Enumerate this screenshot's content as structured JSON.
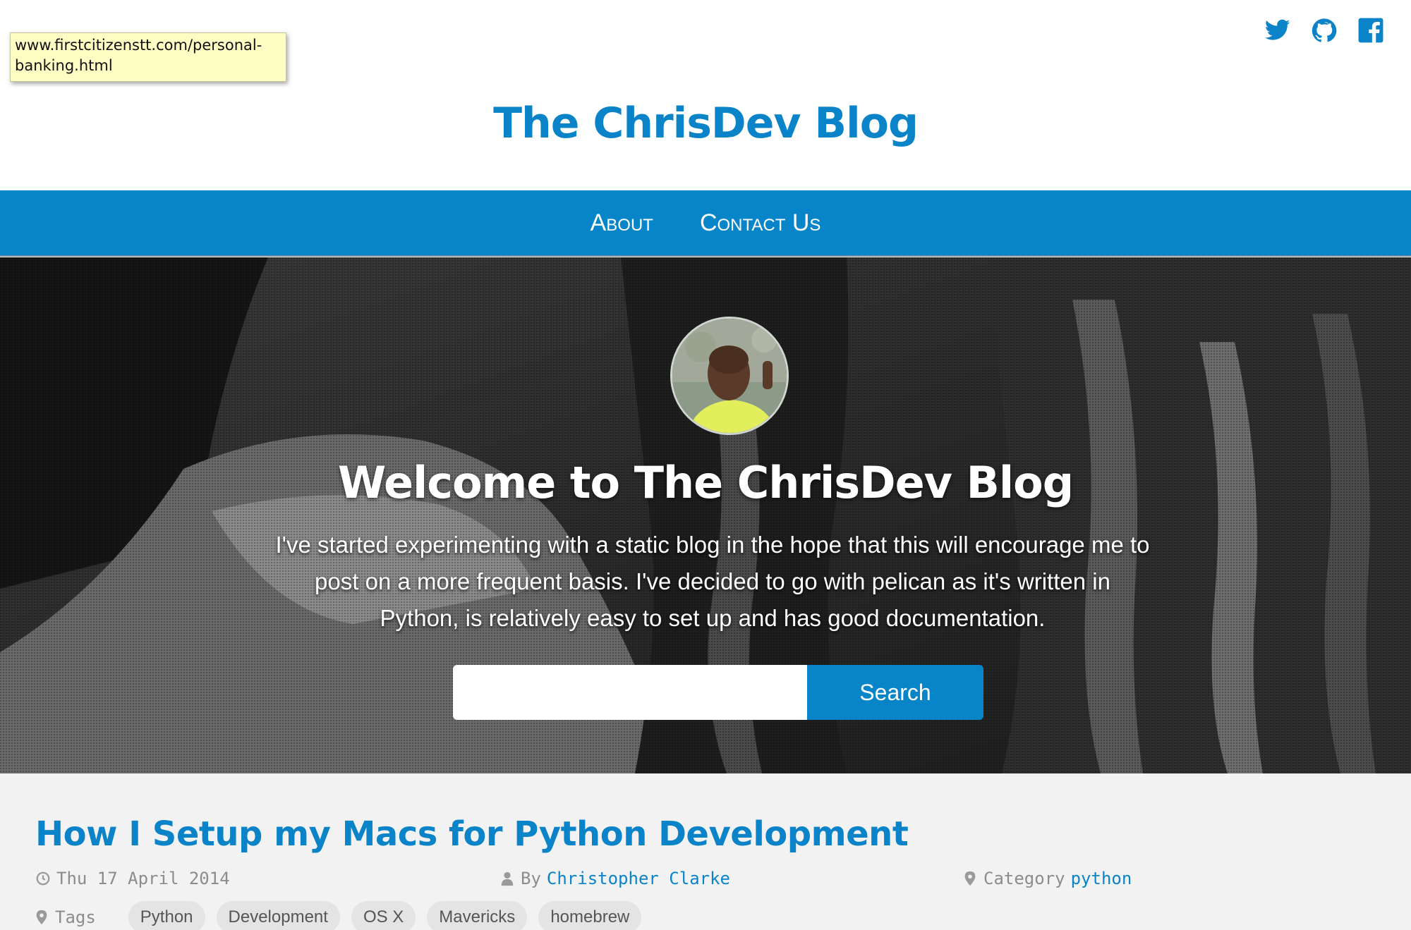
{
  "tooltip": {
    "text": "www.firstcitizenstt.com/personal-banking.html"
  },
  "header": {
    "site_title": "The ChrisDev Blog",
    "social": [
      "twitter-icon",
      "github-icon",
      "facebook-icon"
    ]
  },
  "nav": {
    "items": [
      {
        "label": "About"
      },
      {
        "label": "Contact Us"
      }
    ]
  },
  "hero": {
    "title": "Welcome to The ChrisDev Blog",
    "text": "I've started experimenting with a static blog in the hope that this will encourage me to post on a more frequent basis. I've decided to go with pelican as it's written in Python, is relatively easy to set up and has good documentation.",
    "search": {
      "value": "",
      "button_label": "Search"
    }
  },
  "post": {
    "title": "How I Setup my Macs for Python Development",
    "date": "Thu 17 April 2014",
    "by_label": "By",
    "author": "Christopher Clarke",
    "category_label": "Category",
    "category": "python",
    "tags_label": "Tags",
    "tags": [
      "Python",
      "Development",
      "OS X",
      "Mavericks",
      "homebrew"
    ]
  },
  "colors": {
    "accent": "#0b83c8",
    "nav_bg": "#0885c9",
    "article_bg": "#f2f2f2"
  }
}
